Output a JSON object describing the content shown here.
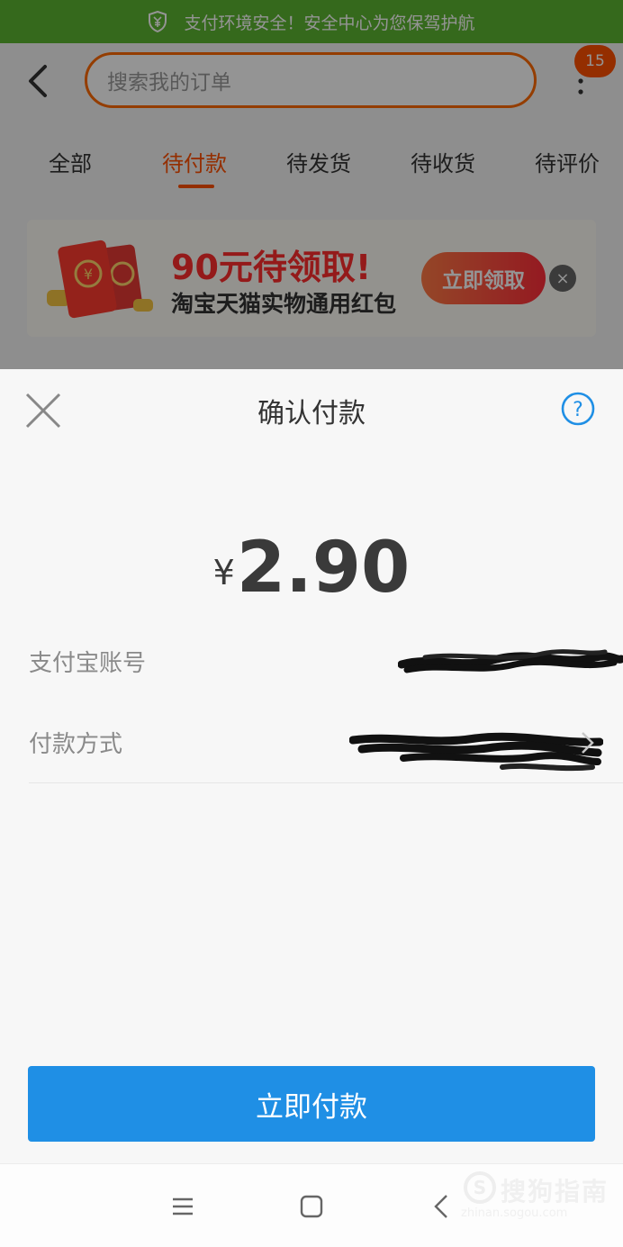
{
  "security_bar": {
    "text": "支付环境安全！安全中心为您保驾护航",
    "icon": "shield-yen-icon",
    "color": "#5cb531"
  },
  "header": {
    "search_placeholder": "搜索我的订单",
    "badge_count": "15",
    "accent": "#ff5000"
  },
  "tabs": [
    {
      "label": "全部",
      "active": false
    },
    {
      "label": "待付款",
      "active": true
    },
    {
      "label": "待发货",
      "active": false
    },
    {
      "label": "待收货",
      "active": false
    },
    {
      "label": "待评价",
      "active": false
    }
  ],
  "promo": {
    "amount_text": "90元待领取!",
    "desc": "淘宝天猫实物通用红包",
    "button": "立即领取",
    "close": "×"
  },
  "sheet": {
    "title": "确认付款",
    "currency": "¥",
    "amount": "2.90",
    "rows": [
      {
        "label": "支付宝账号"
      },
      {
        "label": "付款方式"
      }
    ],
    "pay_button": "立即付款",
    "button_color": "#1f8fe5"
  },
  "navbar": {
    "icons": [
      "menu-icon",
      "home-square-icon",
      "back-chevron-icon"
    ]
  },
  "watermark": {
    "text": "搜狗指南",
    "url": "zhinan.sogou.com"
  }
}
